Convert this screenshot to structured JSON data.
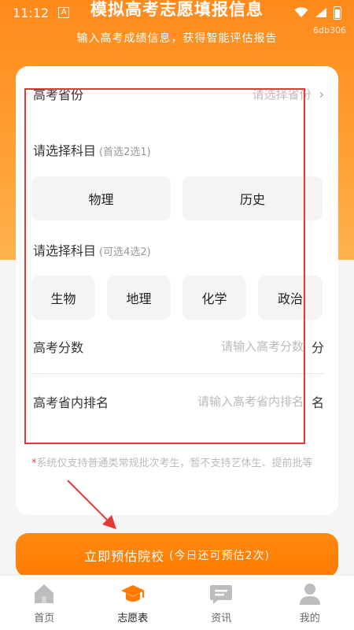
{
  "status_bar": {
    "time": "11:12",
    "notification_glyph": "A"
  },
  "header": {
    "title": "模拟高考志愿填报信息",
    "subtitle": "输入高考成绩信息，获得智能评估报告",
    "build_id": "6db306"
  },
  "form": {
    "province": {
      "label": "高考省份",
      "placeholder": "请选择省份"
    },
    "subject_group_1": {
      "label": "请选择科目",
      "hint": "(首选2选1)",
      "options": [
        "物理",
        "历史"
      ]
    },
    "subject_group_2": {
      "label": "请选择科目",
      "hint": "(可选4选2)",
      "options": [
        "生物",
        "地理",
        "化学",
        "政治"
      ]
    },
    "score": {
      "label": "高考分数",
      "placeholder": "请输入高考分数",
      "unit": "分"
    },
    "rank": {
      "label": "高考省内排名",
      "placeholder": "请输入高考省内排名",
      "unit": "名"
    },
    "notice": {
      "star": "*",
      "text": "系统仅支持普通类常规批次考生，暂不支持艺体生、提前批等"
    }
  },
  "cta": {
    "label": "立即预估院校",
    "sub": "(今日还可预估2次)"
  },
  "tabs": [
    {
      "label": "首页",
      "icon": "home-icon",
      "active": false
    },
    {
      "label": "志愿表",
      "icon": "graduation-cap-icon",
      "active": true
    },
    {
      "label": "资讯",
      "icon": "message-icon",
      "active": false
    },
    {
      "label": "我的",
      "icon": "user-icon",
      "active": false
    }
  ],
  "colors": {
    "accent": "#ff7a00",
    "highlight": "#e53935",
    "tab_active": "#ff7a00",
    "tab_inactive": "#bdbdbd"
  }
}
